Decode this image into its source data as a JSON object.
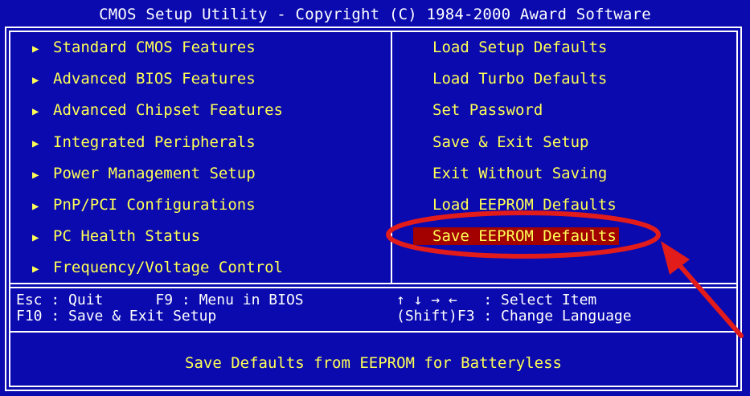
{
  "title": "CMOS Setup Utility - Copyright (C) 1984-2000 Award Software",
  "colors": {
    "background": "#0a0aae",
    "menu_text": "#ffff55",
    "help_text": "#ffffff",
    "highlight": "#a30000",
    "annotation": "#e21b1b"
  },
  "left_menu": [
    {
      "label": "Standard CMOS Features",
      "icon": "submenu-arrow-icon"
    },
    {
      "label": "Advanced BIOS Features",
      "icon": "submenu-arrow-icon"
    },
    {
      "label": "Advanced Chipset Features",
      "icon": "submenu-arrow-icon"
    },
    {
      "label": "Integrated Peripherals",
      "icon": "submenu-arrow-icon"
    },
    {
      "label": "Power Management Setup",
      "icon": "submenu-arrow-icon"
    },
    {
      "label": "PnP/PCI Configurations",
      "icon": "submenu-arrow-icon"
    },
    {
      "label": "PC Health Status",
      "icon": "submenu-arrow-icon"
    },
    {
      "label": "Frequency/Voltage Control",
      "icon": "submenu-arrow-icon"
    }
  ],
  "right_menu": [
    {
      "label": "Load Setup Defaults"
    },
    {
      "label": "Load Turbo Defaults"
    },
    {
      "label": "Set Password"
    },
    {
      "label": "Save & Exit Setup"
    },
    {
      "label": "Exit Without Saving"
    },
    {
      "label": "Load EEPROM Defaults"
    },
    {
      "label": "Save EEPROM Defaults",
      "selected": true
    }
  ],
  "help": {
    "left_line1": "Esc : Quit      F9 : Menu in BIOS",
    "left_line2": "F10 : Save & Exit Setup",
    "right_line1": "↑ ↓ → ←   : Select Item",
    "right_line2": "(Shift)F3 : Change Language"
  },
  "status_line": "Save Defaults from EEPROM for Batteryless"
}
